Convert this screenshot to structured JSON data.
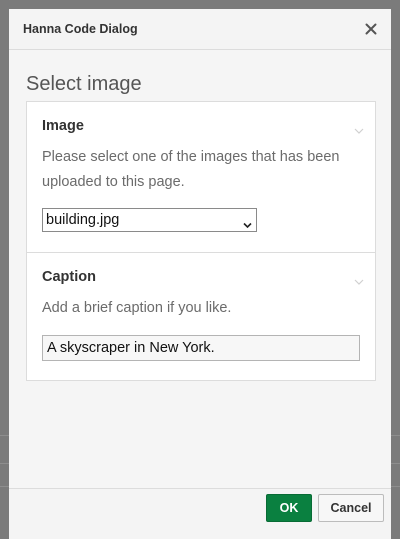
{
  "dialog": {
    "title": "Hanna Code Dialog",
    "close_icon": "close-icon"
  },
  "content": {
    "heading": "Select image"
  },
  "image_section": {
    "title": "Image",
    "description": "Please select one of the images that has been uploaded to this page.",
    "selected_value": "building.jpg"
  },
  "caption_section": {
    "title": "Caption",
    "description": "Add a brief caption if you like.",
    "value": "A skyscraper in New York."
  },
  "footer": {
    "ok_label": "OK",
    "cancel_label": "Cancel"
  },
  "colors": {
    "primary": "#0a8040",
    "backdrop": "#7b7b7b"
  }
}
